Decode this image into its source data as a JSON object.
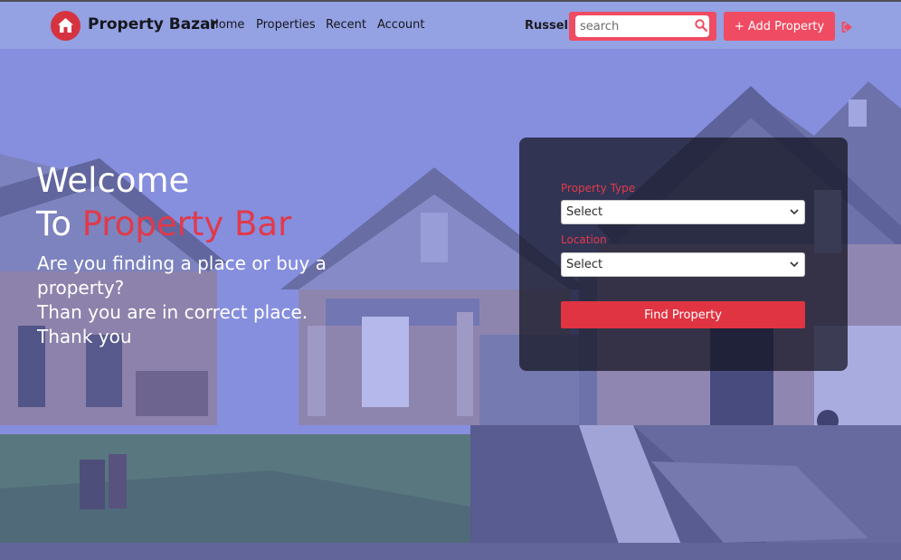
{
  "brand": {
    "name": "Property Bazar",
    "logo_icon": "house-icon",
    "accent": "#d63340"
  },
  "nav": {
    "items": [
      {
        "label": "Home"
      },
      {
        "label": "Properties"
      },
      {
        "label": "Recent"
      },
      {
        "label": "Account"
      }
    ]
  },
  "user": {
    "name": "Russel"
  },
  "search": {
    "placeholder": "search",
    "value": "",
    "icon": "search-icon"
  },
  "add_property_label": "+ Add Property",
  "logout_icon": "logout-icon",
  "hero": {
    "line1": "Welcome",
    "line2_prefix": "To ",
    "line2_accent": "Property Bar",
    "line3": "Are you finding a place or buy a property?",
    "line4": "Than you are in correct place.",
    "line5": "Thank you"
  },
  "search_panel": {
    "type_label": "Property Type",
    "type_value": "Select",
    "location_label": "Location",
    "location_value": "Select",
    "find_button": "Find Property"
  },
  "colors": {
    "primary": "#ef4b62",
    "accent_text": "#e03a4a",
    "tint": "#6c72e0"
  }
}
